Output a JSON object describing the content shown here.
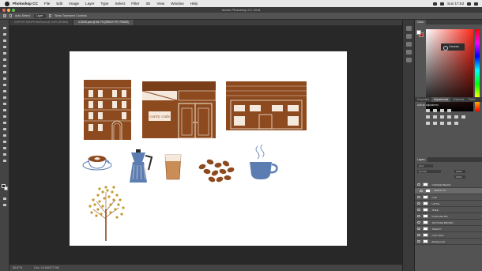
{
  "menubar": {
    "app": "Photoshop CC",
    "items": [
      "File",
      "Edit",
      "Image",
      "Layer",
      "Type",
      "Select",
      "Filter",
      "3D",
      "View",
      "Window",
      "Help"
    ],
    "clock": "Sun 17:53"
  },
  "window": {
    "title": "Adobe Photoshop CC 2018"
  },
  "options": {
    "auto_select": "Auto-Select:",
    "auto_select_value": "Layer",
    "show_transform": "Show Transform Controls"
  },
  "tabs": [
    "COFFEE SHOPS MAP.psd @ 100% (RGB/8)",
    "ICONS.psd @ 66.7% (BRICK PIT, RGB/8)"
  ],
  "status": {
    "zoom": "66.67%",
    "doc": "Doc: 13.4M/277.9M"
  },
  "color_panel": {
    "tab": "Color",
    "library_tip": "Libraries"
  },
  "adjust_panel": {
    "tabs": [
      "Properties",
      "Adjustments",
      "Channels",
      "Paths"
    ],
    "hint": "Add an adjustment"
  },
  "layers_panel": {
    "tab": "Layers",
    "kind": "Kind",
    "mode": "Normal",
    "opacity": "100%",
    "fill": "100%",
    "layers": [
      {
        "name": "COFFEE BEANS",
        "selected": false
      },
      {
        "name": "BRICK PIT",
        "selected": true
      },
      {
        "name": "CUP",
        "selected": false
      },
      {
        "name": "LATTE",
        "selected": false
      },
      {
        "name": "TREE",
        "selected": false
      },
      {
        "name": "ICON AND BG",
        "selected": false
      },
      {
        "name": "TEXTURE BROWN",
        "selected": false
      },
      {
        "name": "TEAPOT",
        "selected": false
      },
      {
        "name": "CUP ICON",
        "selected": false
      },
      {
        "name": "Background",
        "selected": false
      }
    ]
  },
  "canvas_art": {
    "storefront_sign": "corry cafe"
  },
  "colors": {
    "brown": "#8d4a1e",
    "blue": "#5b7db1",
    "latte": "#c98d55",
    "tree_leaf": "#c49a2c"
  }
}
